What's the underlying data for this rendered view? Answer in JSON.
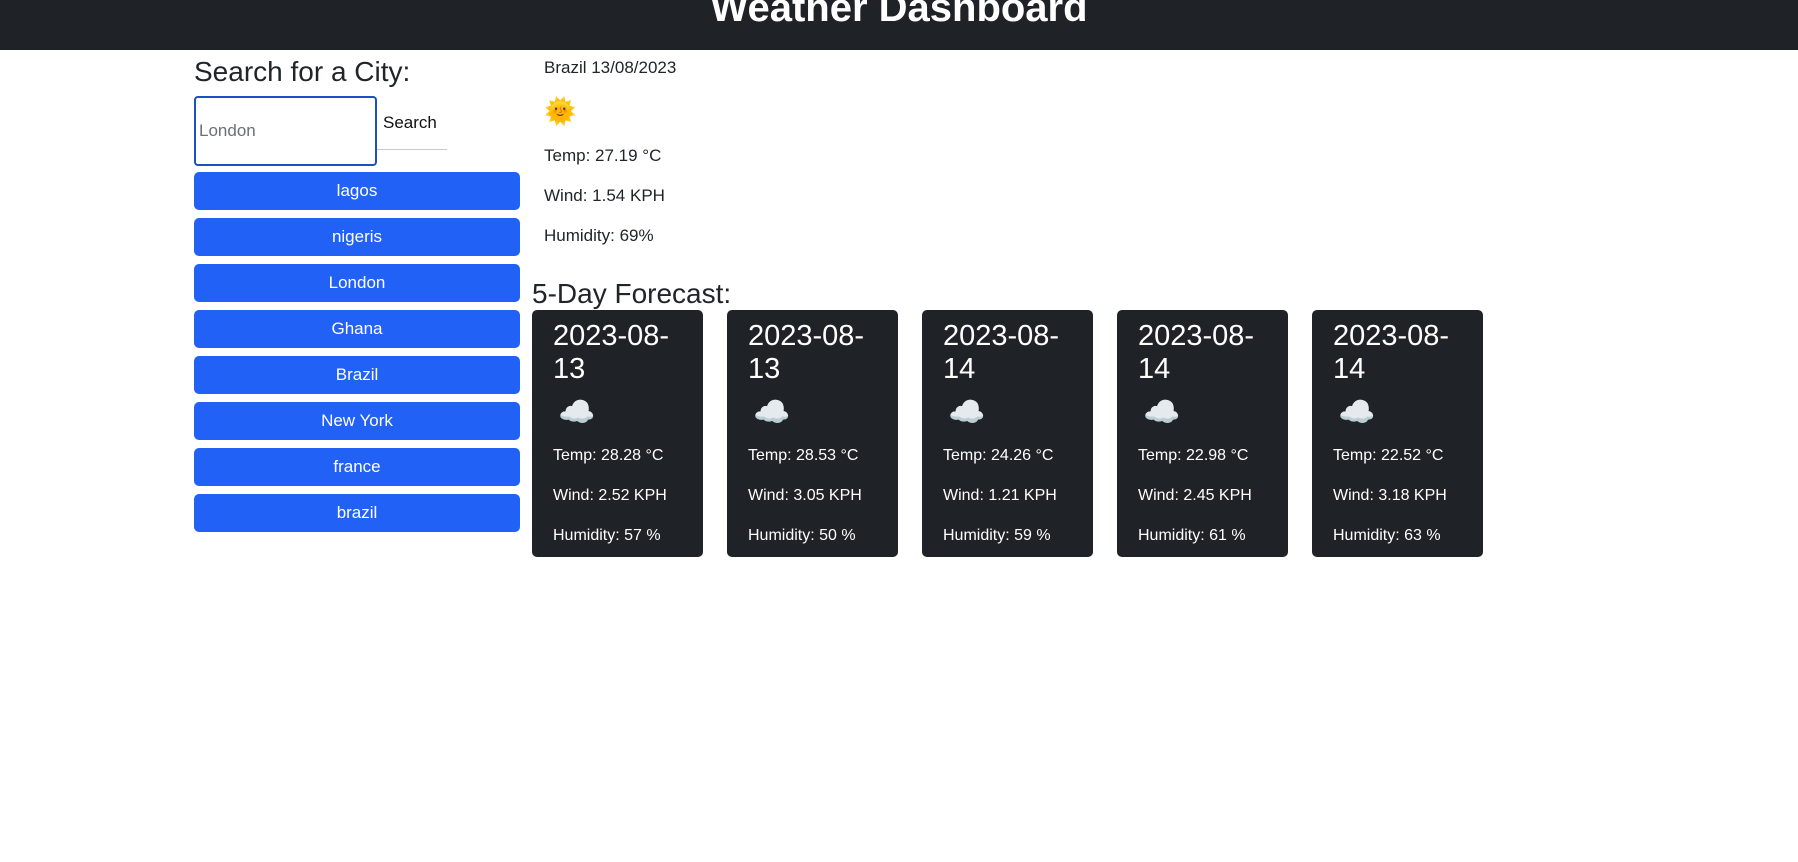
{
  "header": {
    "title": "Weather Dashboard"
  },
  "search": {
    "heading": "Search for a City:",
    "placeholder": "London",
    "value": "",
    "button_label": "Search"
  },
  "history": [
    "lagos",
    "nigeris",
    "London",
    "Ghana",
    "Brazil",
    "New York",
    "france",
    "brazil"
  ],
  "current": {
    "city_date": "Brazil 13/08/2023",
    "icon": "sunny-icon",
    "icon_glyph": "🌞",
    "temp": "Temp: 27.19 °C",
    "wind": "Wind: 1.54 KPH",
    "humidity": "Humidity: 69%"
  },
  "forecast": {
    "title": "5-Day Forecast:",
    "days": [
      {
        "date": "2023-08-13",
        "icon": "cloud-icon",
        "icon_glyph": "☁️",
        "temp": "Temp: 28.28 °C",
        "wind": "Wind: 2.52 KPH",
        "humidity": "Humidity: 57 %"
      },
      {
        "date": "2023-08-13",
        "icon": "broken-clouds-icon",
        "icon_glyph": "☁️",
        "temp": "Temp: 28.53 °C",
        "wind": "Wind: 3.05 KPH",
        "humidity": "Humidity: 50 %"
      },
      {
        "date": "2023-08-14",
        "icon": "broken-clouds-icon",
        "icon_glyph": "☁️",
        "temp": "Temp: 24.26 °C",
        "wind": "Wind: 1.21 KPH",
        "humidity": "Humidity: 59 %"
      },
      {
        "date": "2023-08-14",
        "icon": "broken-clouds-icon",
        "icon_glyph": "☁️",
        "temp": "Temp: 22.98 °C",
        "wind": "Wind: 2.45 KPH",
        "humidity": "Humidity: 61 %"
      },
      {
        "date": "2023-08-14",
        "icon": "broken-clouds-icon",
        "icon_glyph": "☁️",
        "temp": "Temp: 22.52 °C",
        "wind": "Wind: 3.18 KPH",
        "humidity": "Humidity: 63 %"
      }
    ]
  },
  "colors": {
    "header_bg": "#1f2226",
    "button_blue": "#2161f5",
    "card_bg": "#1f2226",
    "input_focus": "#1b4fc2"
  }
}
